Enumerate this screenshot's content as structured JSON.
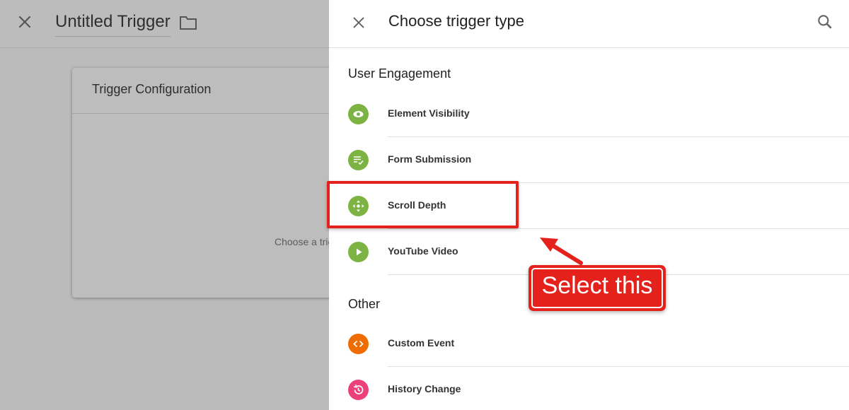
{
  "background": {
    "title": "Untitled Trigger",
    "card_title": "Trigger Configuration",
    "card_hint": "Choose a trigger type to begin setup..."
  },
  "panel": {
    "title": "Choose trigger type",
    "sections": [
      {
        "title": "User Engagement",
        "items": [
          {
            "label": "Element Visibility",
            "icon": "eye-icon",
            "color": "#7cb342"
          },
          {
            "label": "Form Submission",
            "icon": "form-check-icon",
            "color": "#7cb342"
          },
          {
            "label": "Scroll Depth",
            "icon": "scroll-arrows-icon",
            "color": "#7cb342"
          },
          {
            "label": "YouTube Video",
            "icon": "play-icon",
            "color": "#7cb342"
          }
        ]
      },
      {
        "title": "Other",
        "items": [
          {
            "label": "Custom Event",
            "icon": "code-icon",
            "color": "#ef6c00"
          },
          {
            "label": "History Change",
            "icon": "history-icon",
            "color": "#ec407a"
          }
        ]
      }
    ]
  },
  "annotation": {
    "callout_text": "Select this",
    "color": "#e4221b"
  }
}
